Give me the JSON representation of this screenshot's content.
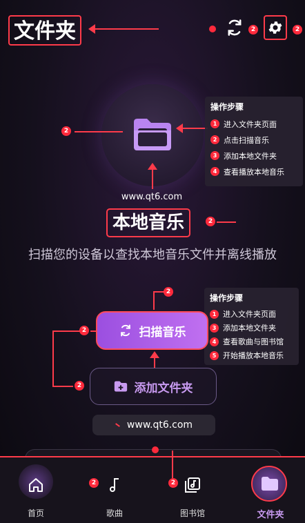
{
  "header": {
    "title": "文件夹"
  },
  "hero": {
    "watermark": "www.qt6.com"
  },
  "section": {
    "heading": "本地音乐",
    "description": "扫描您的设备以查找本地音乐文件并离线播放"
  },
  "steps_top": {
    "title": "操作步骤",
    "items": [
      {
        "n": "1",
        "text": "进入文件夹页面"
      },
      {
        "n": "2",
        "text": "点击扫描音乐"
      },
      {
        "n": "3",
        "text": "添加本地文件夹"
      },
      {
        "n": "4",
        "text": "查看播放本地音乐"
      }
    ]
  },
  "steps_bottom": {
    "title": "操作步骤",
    "items": [
      {
        "n": "1",
        "text": "进入文件夹页面"
      },
      {
        "n": "3",
        "text": "添加本地文件夹"
      },
      {
        "n": "4",
        "text": "查看歌曲与图书馆"
      },
      {
        "n": "5",
        "text": "开始播放本地音乐"
      }
    ]
  },
  "buttons": {
    "scan": "扫描音乐",
    "add_folder": "添加文件夹"
  },
  "footer_url": "www.qt6.com",
  "badges": {
    "num": "2"
  },
  "nav": {
    "home": "首页",
    "songs": "歌曲",
    "library": "图书馆",
    "folders": "文件夹"
  },
  "colors": {
    "accent_red": "#ff2a3c",
    "purple": "#b070f0",
    "bg": "#15101d"
  }
}
